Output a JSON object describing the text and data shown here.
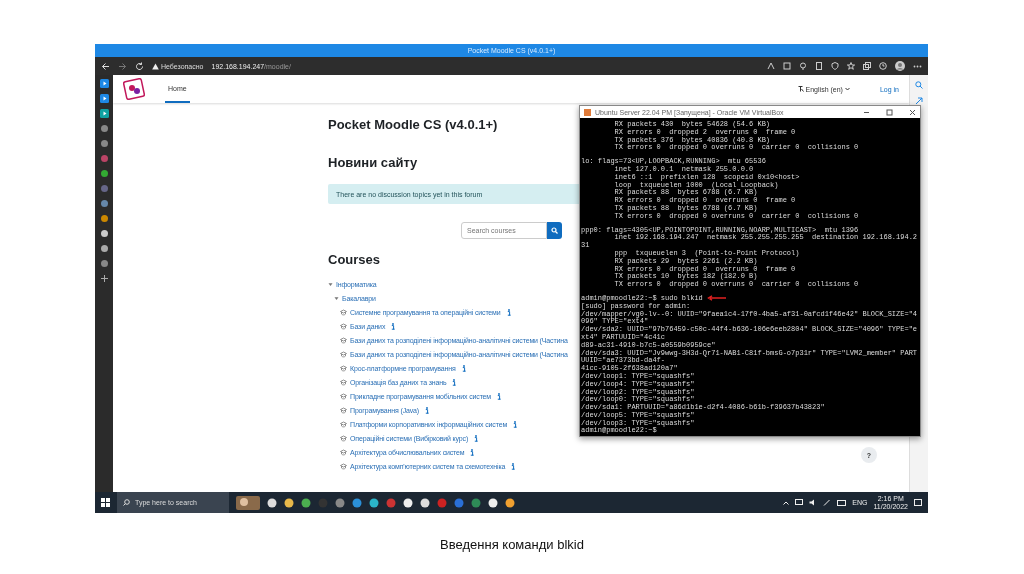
{
  "browser": {
    "title": "Pocket Moodle CS (v4.0.1+)",
    "security_label": "Небезопасно",
    "url_host": "192.168.194.247",
    "url_path": "/moodle/"
  },
  "navbar": {
    "tabs": [
      {
        "label": "Home",
        "selected": true
      }
    ],
    "language": "English (en)",
    "login": "Log in"
  },
  "page": {
    "site_title": "Pocket Moodle CS (v4.0.1+)",
    "news_heading": "Новини сайту",
    "news_notice": "There are no discussion topics yet in this forum",
    "search": {
      "placeholder": "Search courses"
    },
    "courses_heading": "Courses",
    "categories": [
      {
        "label": "Інформатика",
        "expanded": true,
        "children": [
          {
            "label": "Бакалаври",
            "expanded": true,
            "courses": [
              {
                "name": "Системне програмування та операційні системи",
                "has_info": true
              },
              {
                "name": "Бази даних",
                "has_info": true
              },
              {
                "name": "Бази даних та розподілені інформаційно-аналітичні системи (Частина",
                "has_info": false
              },
              {
                "name": "Бази даних та розподілені інформаційно-аналітичні системи (Частина",
                "has_info": false
              },
              {
                "name": "Крос-платформне програмування",
                "has_info": true
              },
              {
                "name": "Організація баз даних та знань",
                "has_info": true
              },
              {
                "name": "Прикладне програмування мобільних систем",
                "has_info": true
              },
              {
                "name": "Програмування (Java)",
                "has_info": true
              },
              {
                "name": "Платформи корпоративних інформаційних систем",
                "has_info": true
              },
              {
                "name": "Операційні системи (Вибірковий курс)",
                "has_info": true
              },
              {
                "name": "Архітектура обчислювальних систем",
                "has_info": true
              },
              {
                "name": "Архітектура комп'ютерних систем та схемотехніка",
                "has_info": true
              }
            ]
          }
        ]
      }
    ]
  },
  "help_button": "?",
  "terminal": {
    "title": "Ubuntu Server 22.04 PM [Запущена] - Oracle VM VirtualBox",
    "blocks": [
      {
        "lines": [
          {
            "text": "        RX packets 430  bytes 54628 (54.6 KB)",
            "marked": false
          },
          {
            "text": "        RX errors 0  dropped 2  overruns 0  frame 0",
            "marked": false
          },
          {
            "text": "        TX packets 376  bytes 40836 (40.8 KB)",
            "marked": false
          },
          {
            "text": "        TX errors 0  dropped 0 overruns 0  carrier 0  collisions 0",
            "marked": false
          }
        ]
      },
      {
        "lines": [
          {
            "text": "lo: flags=73<UP,LOOPBACK,RUNNING>  mtu 65536",
            "marked": false
          },
          {
            "text": "        inet 127.0.0.1  netmask 255.0.0.0",
            "marked": false
          },
          {
            "text": "        inet6 ::1  prefixlen 128  scopeid 0x10<host>",
            "marked": false
          },
          {
            "text": "        loop  txqueuelen 1000  (Local Loopback)",
            "marked": false
          },
          {
            "text": "        RX packets 88  bytes 6788 (6.7 KB)",
            "marked": false
          },
          {
            "text": "        RX errors 0  dropped 0  overruns 0  frame 0",
            "marked": false
          },
          {
            "text": "        TX packets 88  bytes 6788 (6.7 KB)",
            "marked": false
          },
          {
            "text": "        TX errors 0  dropped 0 overruns 0  carrier 0  collisions 0",
            "marked": false
          }
        ]
      },
      {
        "lines": [
          {
            "text": "ppp0: flags=4305<UP,POINTOPOINT,RUNNING,NOARP,MULTICAST>  mtu 1396",
            "marked": false
          },
          {
            "text": "        inet 192.168.194.247  netmask 255.255.255.255  destination 192.168.194.231",
            "marked": false
          },
          {
            "text": "        ppp  txqueuelen 3  (Point-to-Point Protocol)",
            "marked": false
          },
          {
            "text": "        RX packets 29  bytes 2261 (2.2 KB)",
            "marked": false
          },
          {
            "text": "        RX errors 0  dropped 0  overruns 0  frame 0",
            "marked": false
          },
          {
            "text": "        TX packets 10  bytes 182 (182.0 B)",
            "marked": false
          },
          {
            "text": "        TX errors 0  dropped 0 overruns 0  carrier 0  collisions 0",
            "marked": false
          }
        ]
      },
      {
        "lines": [
          {
            "text": "admin@pmoodle22:~$ sudo blkid",
            "marked": true
          },
          {
            "text": "[sudo] password for admin:",
            "marked": false
          },
          {
            "text": "/dev/mapper/vg0-lv--0: UUID=\"9faea1c4-17f0-4ba5-af31-0afcd1f46e42\" BLOCK_SIZE=\"4096\" TYPE=\"ext4\"",
            "marked": false
          },
          {
            "text": "/dev/sda2: UUID=\"97b76459-c50c-44f4-b636-106e6eeb2804\" BLOCK_SIZE=\"4096\" TYPE=\"ext4\" PARTUUID=\"4c41c",
            "marked": false
          },
          {
            "text": "d89-ac31-4910-b7c5-a0559b0959ce\"",
            "marked": false
          },
          {
            "text": "/dev/sda3: UUID=\"Jv9wwg-3H3d-Qr71-NAB1-C81f-bmsG-o7p31r\" TYPE=\"LVM2_member\" PARTUUID=\"ae7373bd-da4f-",
            "marked": false
          },
          {
            "text": "41cc-9105-2f638ad120a7\"",
            "marked": false
          },
          {
            "text": "/dev/loop1: TYPE=\"squashfs\"",
            "marked": false
          },
          {
            "text": "/dev/loop4: TYPE=\"squashfs\"",
            "marked": false
          },
          {
            "text": "/dev/loop2: TYPE=\"squashfs\"",
            "marked": false
          },
          {
            "text": "/dev/loop0: TYPE=\"squashfs\"",
            "marked": false
          },
          {
            "text": "/dev/sda1: PARTUUID=\"a86d1b1e-d2f4-4086-b61b-f39637b43823\"",
            "marked": false
          },
          {
            "text": "/dev/loop5: TYPE=\"squashfs\"",
            "marked": false
          },
          {
            "text": "/dev/loop3: TYPE=\"squashfs\"",
            "marked": false
          },
          {
            "text": "admin@pmoodle22:~$",
            "marked": false
          }
        ]
      }
    ]
  },
  "taskbar": {
    "search_placeholder": "Type here to search",
    "language": "ENG",
    "time": "2:16 PM",
    "date": "11/20/2022"
  },
  "slide": {
    "caption": "Введення команди blkid"
  }
}
